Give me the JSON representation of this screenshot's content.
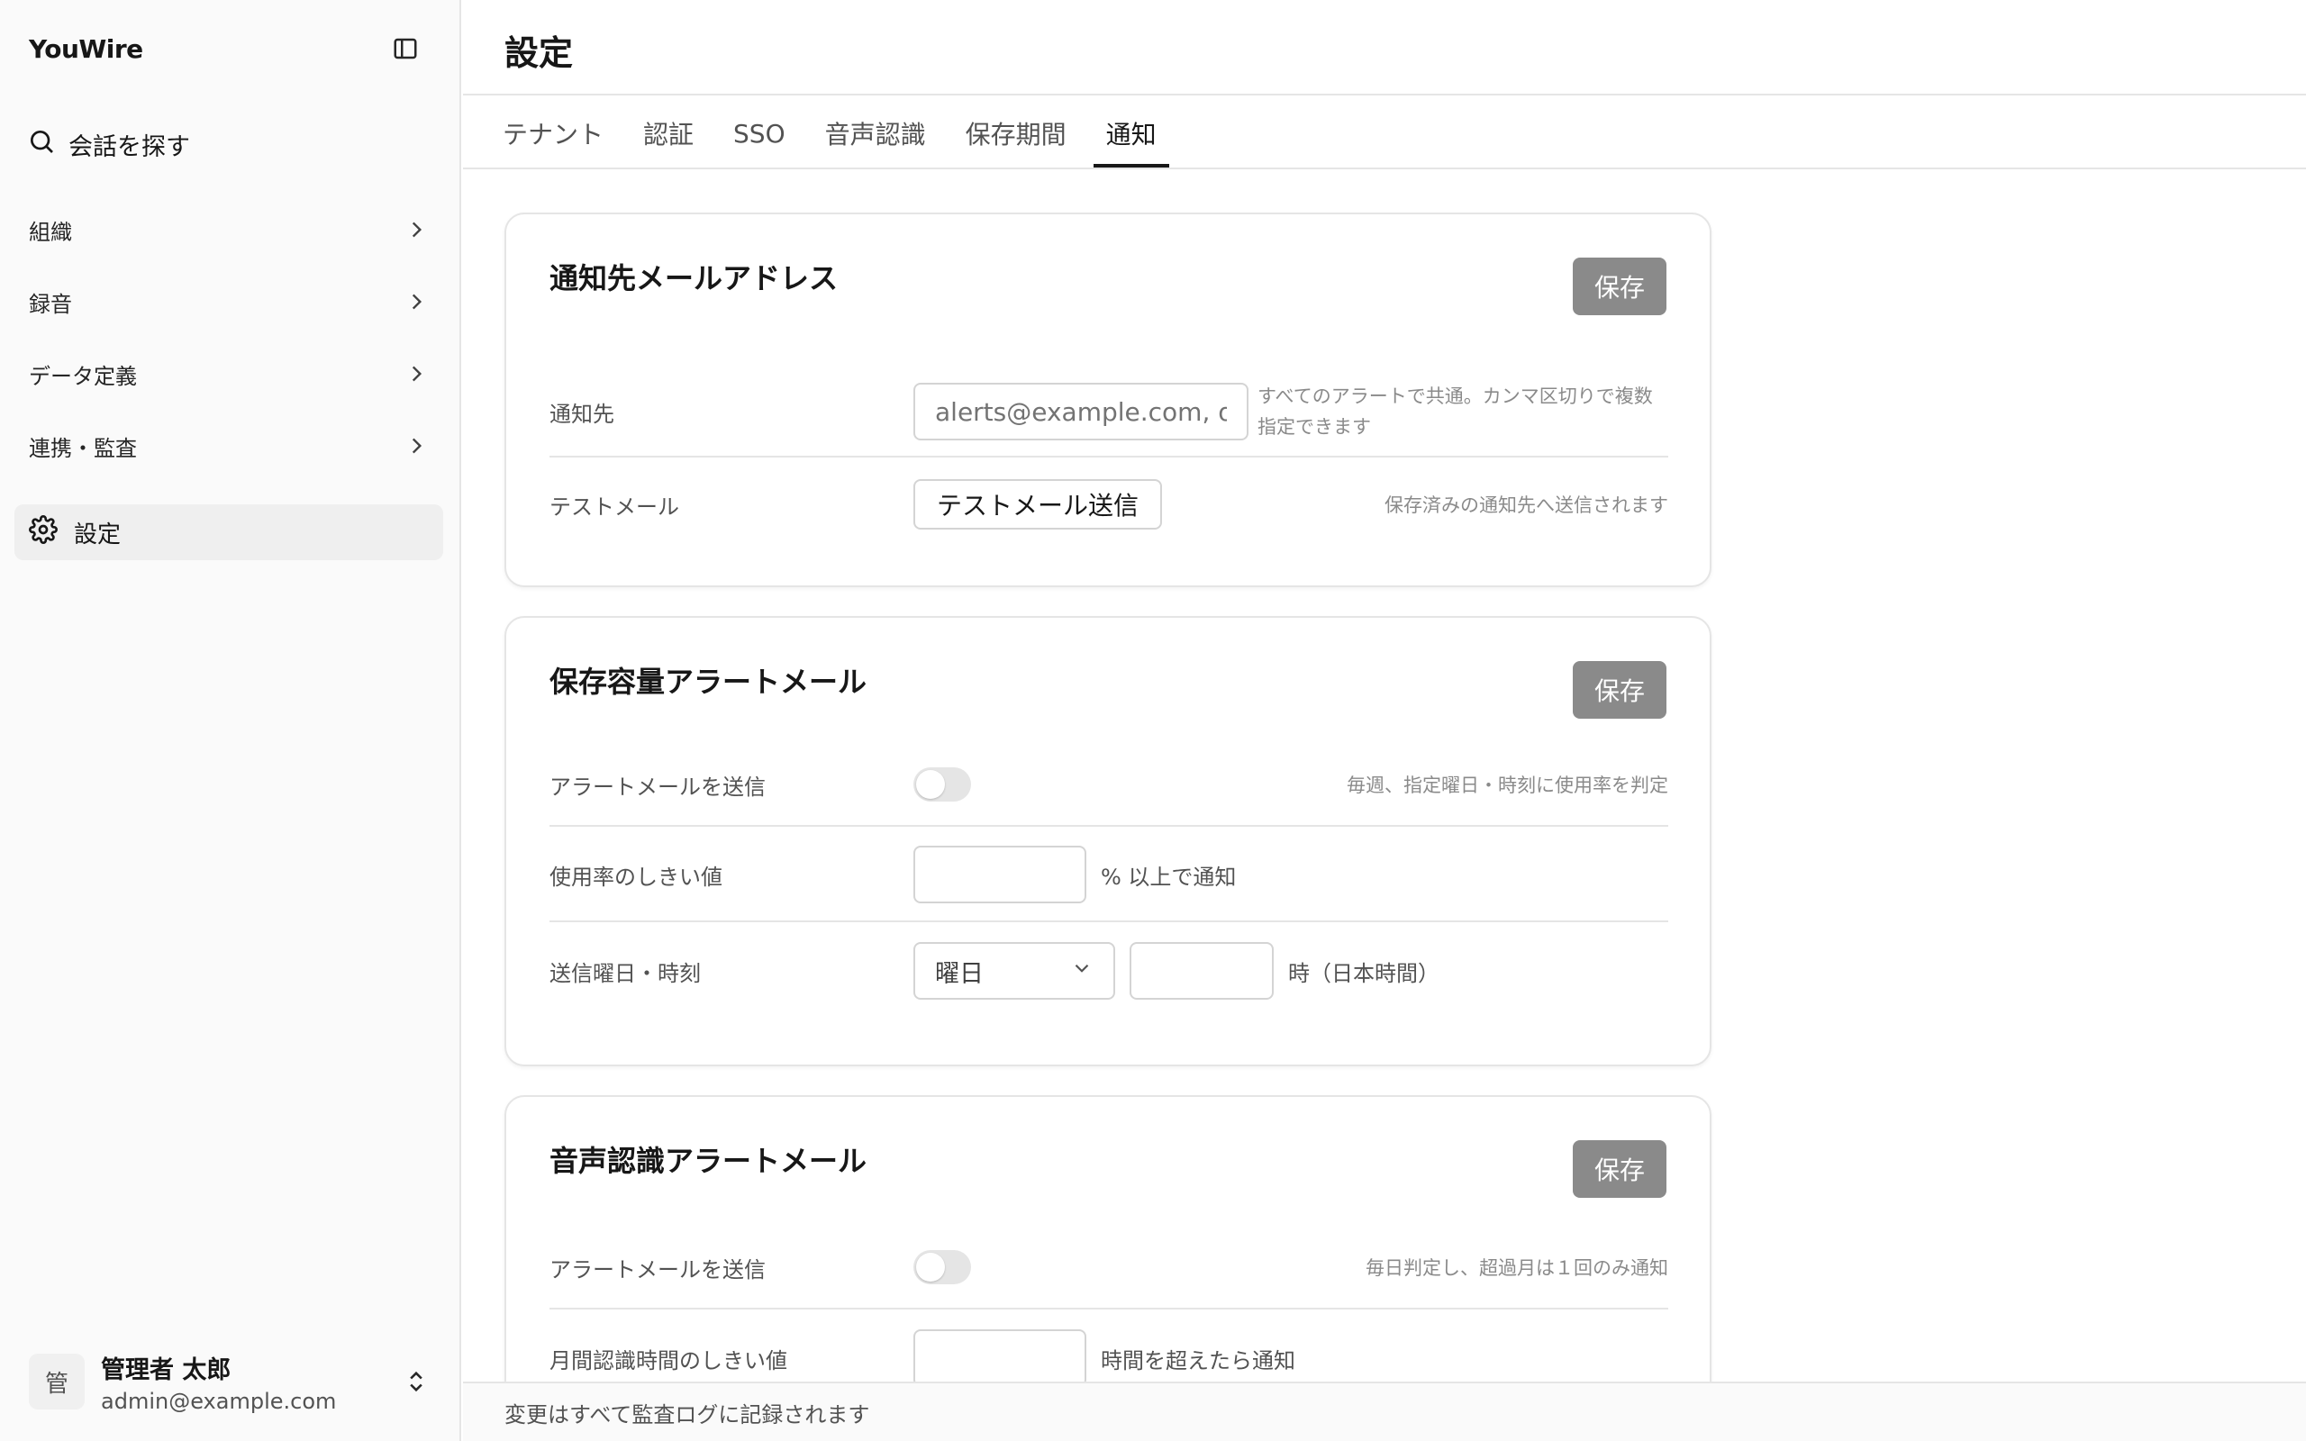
{
  "app": {
    "brand": "YouWire"
  },
  "sidebar": {
    "search_label": "会話を探す",
    "items": [
      {
        "label": "組織"
      },
      {
        "label": "録音"
      },
      {
        "label": "データ定義"
      },
      {
        "label": "連携・監査"
      }
    ],
    "active_item": {
      "label": "設定"
    },
    "user": {
      "avatar": "管",
      "name": "管理者 太郎",
      "email": "admin@example.com"
    }
  },
  "page": {
    "title": "設定"
  },
  "tabs": [
    {
      "label": "テナント"
    },
    {
      "label": "認証"
    },
    {
      "label": "SSO"
    },
    {
      "label": "音声認識"
    },
    {
      "label": "保存期間"
    },
    {
      "label": "通知"
    }
  ],
  "active_tab": "通知",
  "cards": {
    "email": {
      "title": "通知先メールアドレス",
      "save": "保存",
      "recipients_label": "通知先",
      "recipients_placeholder": "alerts@example.com, ops@example.com",
      "recipients_hint": "すべてのアラートで共通。カンマ区切りで複数指定できます",
      "test_label": "テストメール",
      "test_button": "テストメール送信",
      "test_hint": "保存済みの通知先へ送信されます"
    },
    "storage": {
      "title": "保存容量アラートメール",
      "save": "保存",
      "send_label": "アラートメールを送信",
      "send_enabled": false,
      "send_hint": "毎週、指定曜日・時刻に使用率を判定",
      "threshold_label": "使用率のしきい値",
      "threshold_value": "",
      "threshold_unit": "% 以上で通知",
      "schedule_label": "送信曜日・時刻",
      "weekday_value": "曜日",
      "hour_value": "",
      "hour_unit": "時（日本時間）"
    },
    "asr": {
      "title": "音声認識アラートメール",
      "save": "保存",
      "send_label": "アラートメールを送信",
      "send_enabled": false,
      "send_hint": "毎日判定し、超過月は１回のみ通知",
      "threshold_label": "月間認識時間のしきい値",
      "threshold_value": "",
      "threshold_unit": "時間を超えたら通知"
    }
  },
  "footer": {
    "note": "変更はすべて監査ログに記録されます"
  },
  "colors": {
    "accent": "#171717",
    "save_button": "#8a8a8a",
    "border": "#e5e5e5",
    "sidebar_bg": "#fafafa"
  }
}
